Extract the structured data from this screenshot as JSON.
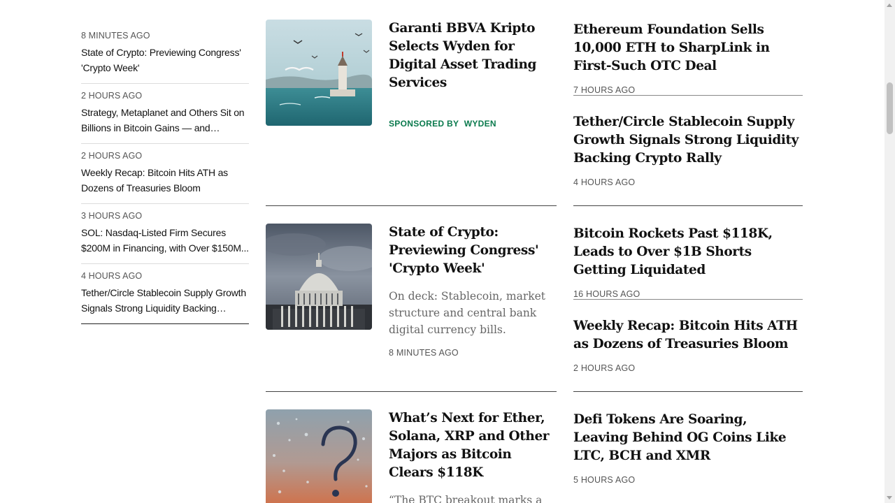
{
  "latest": [
    {
      "time": "8 MINUTES AGO",
      "title": "State of Crypto: Previewing Congress' 'Crypto Week'"
    },
    {
      "time": "2 HOURS AGO",
      "title": "Strategy, Metaplanet and Others Sit on Billions in Bitcoin Gains — and They're..."
    },
    {
      "time": "2 HOURS AGO",
      "title": "Weekly Recap: Bitcoin Hits ATH as Dozens of Treasuries Bloom"
    },
    {
      "time": "3 HOURS AGO",
      "title": "SOL: Nasdaq-Listed Firm Secures $200M in Financing, with Over $150M..."
    },
    {
      "time": "4 HOURS AGO",
      "title": "Tether/Circle Stablecoin Supply Growth Signals Strong Liquidity Backing Crypto..."
    }
  ],
  "features": [
    {
      "title": "Garanti BBVA Kripto Selects Wyden for Digital Asset Trading Services",
      "sponsored_label": "SPONSORED BY",
      "sponsor": "WYDEN",
      "image": "istanbul-maiden-tower-photo"
    },
    {
      "title": "State of Crypto: Previewing Congress' 'Crypto Week'",
      "description": "On deck: Stablecoin, market structure and central bank digital currency bills.",
      "time": "8 MINUTES AGO",
      "image": "us-capitol-dome-photo"
    },
    {
      "title": "What’s Next for Ether, Solana, XRP and Other Majors as Bitcoin Clears $118K",
      "description": "“The BTC breakout marks a",
      "image": "question-mark-on-window-photo"
    }
  ],
  "right": [
    {
      "title": "Ethereum Foundation Sells 10,000 ETH to SharpLink in First-Such OTC Deal",
      "time": "7 HOURS AGO"
    },
    {
      "title": "Tether/Circle Stablecoin Supply Growth Signals Strong Liquidity Backing Crypto Rally",
      "time": "4 HOURS AGO"
    },
    {
      "title": "Bitcoin Rockets Past $118K, Leads to Over $1B Shorts Getting Liquidated",
      "time": "16 HOURS AGO"
    },
    {
      "title": "Weekly Recap: Bitcoin Hits ATH as Dozens of Treasuries Bloom",
      "time": "2 HOURS AGO"
    },
    {
      "title": "Defi Tokens Are Soaring, Leaving Behind OG Coins Like LTC, BCH and XMR",
      "time": "5 HOURS AGO"
    }
  ],
  "colors": {
    "sponsor": "#0a7a4d",
    "text": "#111111",
    "muted": "#555555"
  }
}
